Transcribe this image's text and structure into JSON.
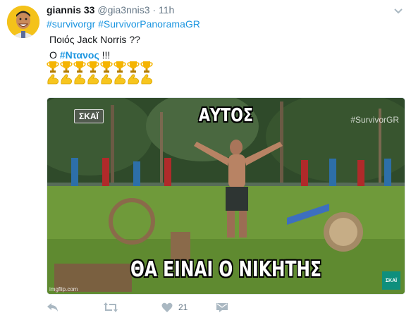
{
  "tweet": {
    "display_name": "giannis 33",
    "handle": "@gia3nnis3",
    "separator": "·",
    "time": "11h",
    "hashtag_1": "#survivorgr",
    "hashtag_2": "#SurvivorPanoramaGR",
    "line_2": "Ποιός Jack Norris ??",
    "line_3_prefix": "Ο",
    "line_3_tag": "#Ντανος",
    "line_3_suffix": "!!!",
    "emoji_trophy_count": 8,
    "emoji_muscle_count": 8
  },
  "media": {
    "top_caption": "ΑΥΤΟΣ",
    "bottom_caption": "ΘΑ ΕΙΝΑΙ Ο ΝΙΚΗΤΗΣ",
    "logo_top": "ΣΚΑΪ",
    "watermark": "#SurvivorGR",
    "logo_bottom": "ΣΚΑΪ",
    "credit": "imgflip.com"
  },
  "actions": {
    "like_count": "21",
    "icons": [
      "reply-icon",
      "retweet-icon",
      "heart-icon",
      "message-icon"
    ]
  },
  "colors": {
    "link": "#1b95e0",
    "muted": "#657786",
    "icon": "#aab8c2"
  }
}
